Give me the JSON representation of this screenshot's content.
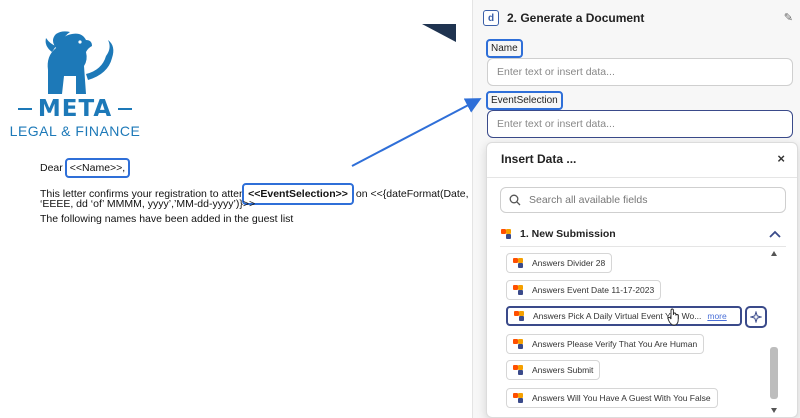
{
  "document": {
    "logo": {
      "name": "META",
      "subtitle": "LEGAL & FINANCE"
    },
    "letter": {
      "dear": "Dear",
      "name_token": "<<Name>>,",
      "line2_before": "This letter confirms your registration to attenc",
      "event_token": "<<EventSelection>>",
      "line2_after": "on <<{dateFormat(Date,",
      "line3": "‘EEEE, dd ‘of’ MMMM, yyyy’,’MM-dd-yyyy’)}>>",
      "line4": "The following names have been added in the guest list"
    }
  },
  "panel": {
    "step_badge": "d",
    "title": "2. Generate a Document",
    "fields": [
      {
        "label": "Name",
        "placeholder": "Enter text or insert data..."
      },
      {
        "label": "EventSelection",
        "placeholder": "Enter text or insert data..."
      }
    ]
  },
  "insert_data": {
    "title": "Insert Data ...",
    "close": "×",
    "search_placeholder": "Search all available fields",
    "group_title": "1. New Submission",
    "items": [
      {
        "label": "Answers Divider 28"
      },
      {
        "label": "Answers Event Date 11-17-2023"
      },
      {
        "label": "Answers Pick A Daily Virtual Event You Wo...",
        "more": "more"
      },
      {
        "label": "Answers Please Verify That You Are Human"
      },
      {
        "label": "Answers Submit"
      },
      {
        "label": "Answers Will You Have A Guest With You False"
      }
    ]
  },
  "colors": {
    "brand_blue": "#1d79b8",
    "highlight_blue": "#2f6fd8",
    "zapier_orange": "#ff4f00",
    "focus_navy": "#3a4a8a"
  }
}
